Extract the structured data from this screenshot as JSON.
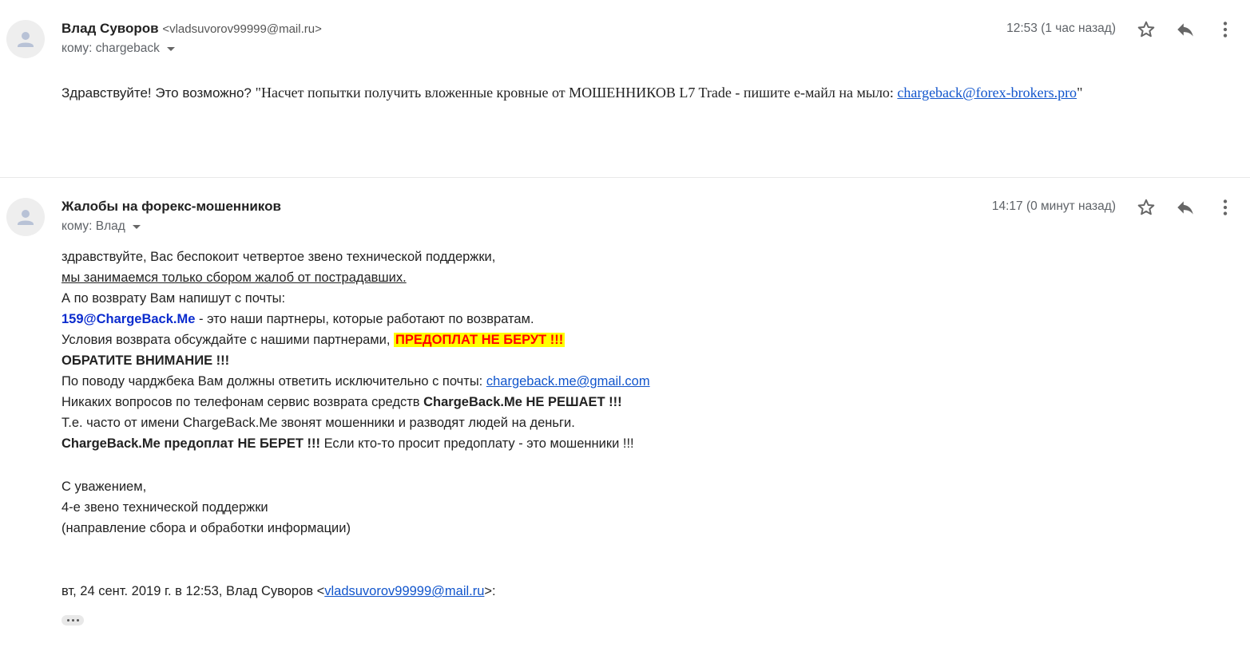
{
  "messages": [
    {
      "sender_name": "Влад Суворов",
      "sender_email": "<vladsuvorov99999@mail.ru>",
      "to_label": "кому: chargeback",
      "time": "12:53 (1 час назад)",
      "body": {
        "greeting": "Здравствуйте! Это возможно? ",
        "quote_open": "\"Насчет попытки получить вложенные кровные от МОШЕННИКОВ L7 Trade - пишите е-майл на мыло: ",
        "link": "chargeback@forex-brokers.pro",
        "quote_close": "\""
      }
    },
    {
      "sender_name": "Жалобы на форекс-мошенников",
      "to_label": "кому: Влад",
      "time": "14:17 (0 минут назад)",
      "body": {
        "line1": "здравствуйте, Вас беспокоит четвертое звено технической поддержки,",
        "line2": "мы занимаемся только сбором жалоб от пострадавших.",
        "line3": "А по возврату Вам напишут с почты:",
        "line4_email": "159@ChargeBack.Me",
        "line4_rest": " - это наши партнеры, которые работают по возвратам.",
        "line5_text": "Условия возврата обсуждайте с нашими партнерами, ",
        "line5_highlight": "ПРЕДОПЛАТ НЕ БЕРУТ !!!",
        "line6": "ОБРАТИТЕ ВНИМАНИЕ !!!",
        "line7_text": "По поводу чарджбека Вам должны ответить исключительно с почты: ",
        "line7_link": "chargeback.me@gmail.com",
        "line8_text": "Никаких вопросов по телефонам сервис возврата средств ",
        "line8_bold": "ChargeBack.Me НЕ РЕШАЕТ !!!",
        "line9": "Т.е. часто от имени ChargeBack.Me звонят мошенники и разводят людей на деньги.",
        "line10_bold": "ChargeBack.Me предоплат НЕ БЕРЕТ !!!",
        "line10_rest": " Если кто-то просит предоплату - это мошенники !!!",
        "sign1": "С уважением,",
        "sign2": "4-е звено технической поддержки",
        "sign3": "(направление сбора и обработки информации)"
      },
      "quote_header": {
        "prefix": "вт, 24 сент. 2019 г. в 12:53, Влад Суворов <",
        "email": "vladsuvorov99999@mail.ru",
        "suffix": ">:"
      }
    }
  ],
  "icons": {
    "avatar": "person-icon",
    "star": "star-icon",
    "reply": "reply-icon",
    "more": "more-vertical-icon",
    "trimmed": "ellipsis-icon"
  },
  "colors": {
    "link": "#1155cc",
    "partner_email": "#0b2cce",
    "highlight_bg": "#ffff00",
    "highlight_text": "#ff0000"
  }
}
